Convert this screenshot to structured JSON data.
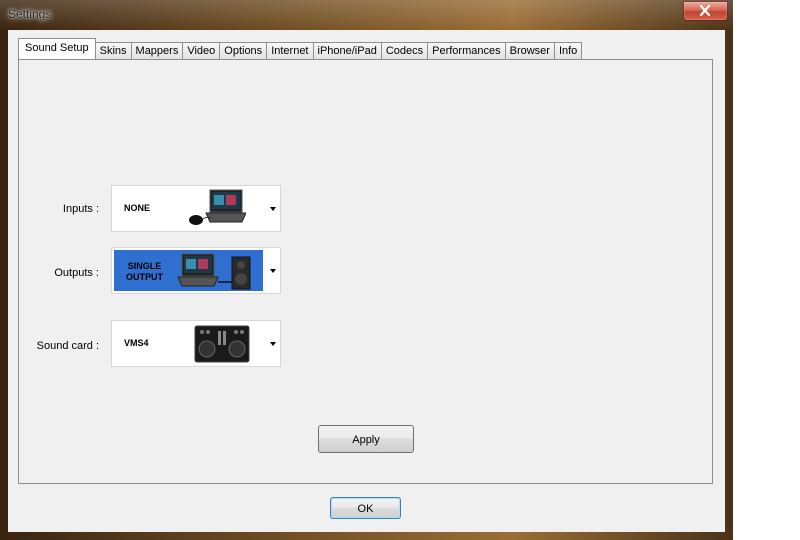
{
  "window": {
    "title": "Settings"
  },
  "tabs": [
    {
      "label": "Sound Setup",
      "active": true
    },
    {
      "label": "Skins"
    },
    {
      "label": "Mappers"
    },
    {
      "label": "Video"
    },
    {
      "label": "Options"
    },
    {
      "label": "Internet"
    },
    {
      "label": "iPhone/iPad"
    },
    {
      "label": "Codecs"
    },
    {
      "label": "Performances"
    },
    {
      "label": "Browser"
    },
    {
      "label": "Info"
    }
  ],
  "sound_setup": {
    "inputs": {
      "label": "Inputs :",
      "value": "NONE",
      "icon": "laptop-with-mouse-icon"
    },
    "outputs": {
      "label": "Outputs :",
      "value_line1": "SINGLE",
      "value_line2": "OUTPUT",
      "icon": "laptop-with-speaker-icon",
      "highlight_color": "#2f6fcf"
    },
    "soundcard": {
      "label": "Sound card :",
      "value": "VMS4",
      "icon": "dj-controller-icon"
    },
    "apply_label": "Apply"
  },
  "footer": {
    "ok_label": "OK"
  }
}
